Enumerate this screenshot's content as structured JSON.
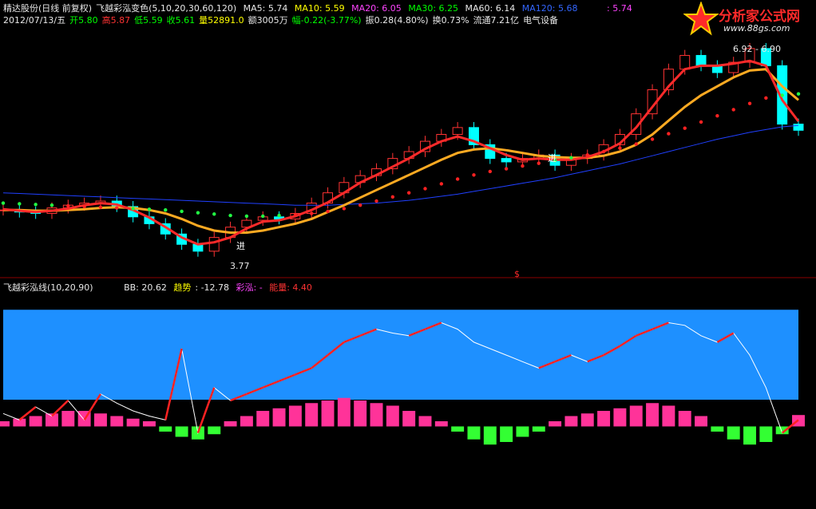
{
  "header": {
    "title": "精达股份(日线 前复权)",
    "indicator": "飞越彩泓变色(5,10,20,30,60,120)",
    "ma5_label": "MA5: 5.74",
    "ma10_label": "MA10: 5.59",
    "ma20_label": "MA20: 6.05",
    "ma30_label": "MA30: 6.25",
    "ma60_label": "MA60: 6.14",
    "ma120_label": "MA120: 5.68",
    "date": "2012/07/13/五",
    "open": "开5.80",
    "high": "高5.87",
    "low": "低5.59",
    "close": "收5.61",
    "volume": "量52891.0",
    "amount": "额3005万",
    "change": "幅-0.22(-3.77%)",
    "amplitude": "振0.28(4.80%)",
    "turnover": "换0.73%",
    "float_value": "流通7.21亿",
    "sector": "电气设备",
    "right_value": ": 5.74"
  },
  "watermark": {
    "title": "分析家公式网",
    "url": "www.88gs.com"
  },
  "indicator_header": {
    "name": "飞越彩泓线(10,20,90)",
    "bb": "BB: 20.62",
    "trend_label": "趋势",
    "trend_value": ": -12.78",
    "rainbow": "彩泓: -",
    "energy": "能量: 4.40"
  },
  "annotations": {
    "high_price": "6.92 - 6.90",
    "low_price": "3.77",
    "buy1": "进",
    "buy2": "进",
    "dollar": "$"
  },
  "chart_data": [
    {
      "type": "line",
      "name": "price",
      "xlabel": "",
      "ylabel": "",
      "ylim": [
        3.5,
        7.1
      ],
      "x": [
        0,
        5,
        10,
        15,
        20,
        25,
        30,
        35,
        40,
        45,
        50,
        55,
        60,
        65,
        70,
        75,
        80,
        85,
        90,
        95,
        100,
        105,
        110,
        115,
        120,
        125,
        130,
        135,
        140,
        145,
        150,
        155,
        160,
        165,
        170,
        175,
        180,
        185,
        190,
        195,
        200,
        205,
        210,
        215,
        220,
        225,
        230,
        235,
        240,
        245
      ],
      "close": [
        4.45,
        4.42,
        4.4,
        4.48,
        4.52,
        4.55,
        4.58,
        4.5,
        4.35,
        4.25,
        4.1,
        3.95,
        3.85,
        4.05,
        4.2,
        4.3,
        4.35,
        4.32,
        4.4,
        4.55,
        4.7,
        4.85,
        4.95,
        5.05,
        5.2,
        5.3,
        5.45,
        5.55,
        5.65,
        5.4,
        5.2,
        5.15,
        5.2,
        5.25,
        5.1,
        5.2,
        5.25,
        5.4,
        5.55,
        5.85,
        6.2,
        6.5,
        6.7,
        6.55,
        6.45,
        6.6,
        6.8,
        6.55,
        5.7,
        5.61
      ],
      "ma5": [
        4.46,
        4.44,
        4.42,
        4.44,
        4.47,
        4.52,
        4.55,
        4.53,
        4.45,
        4.34,
        4.2,
        4.05,
        3.95,
        3.98,
        4.05,
        4.18,
        4.28,
        4.3,
        4.36,
        4.45,
        4.56,
        4.7,
        4.85,
        4.96,
        5.08,
        5.2,
        5.34,
        5.45,
        5.52,
        5.45,
        5.35,
        5.25,
        5.18,
        5.2,
        5.18,
        5.18,
        5.22,
        5.3,
        5.42,
        5.65,
        5.95,
        6.25,
        6.5,
        6.55,
        6.55,
        6.58,
        6.62,
        6.55,
        6.05,
        5.74
      ],
      "ma20": [
        4.45,
        4.45,
        4.44,
        4.44,
        4.45,
        4.46,
        4.48,
        4.49,
        4.48,
        4.45,
        4.4,
        4.32,
        4.22,
        4.15,
        4.12,
        4.12,
        4.15,
        4.2,
        4.25,
        4.32,
        4.42,
        4.52,
        4.63,
        4.74,
        4.85,
        4.96,
        5.07,
        5.18,
        5.28,
        5.33,
        5.35,
        5.32,
        5.28,
        5.24,
        5.22,
        5.21,
        5.21,
        5.24,
        5.3,
        5.4,
        5.55,
        5.75,
        5.95,
        6.12,
        6.25,
        6.38,
        6.48,
        6.5,
        6.25,
        6.05
      ],
      "ma60": [
        4.55,
        4.54,
        4.53,
        4.52,
        4.51,
        4.5,
        4.49,
        4.48,
        4.47,
        4.46,
        4.45,
        4.43,
        4.41,
        4.39,
        4.37,
        4.36,
        4.36,
        4.37,
        4.38,
        4.4,
        4.43,
        4.47,
        4.52,
        4.58,
        4.64,
        4.7,
        4.76,
        4.83,
        4.9,
        4.96,
        5.01,
        5.05,
        5.09,
        5.13,
        5.17,
        5.21,
        5.25,
        5.3,
        5.35,
        5.41,
        5.48,
        5.56,
        5.64,
        5.73,
        5.82,
        5.91,
        6.0,
        6.08,
        6.12,
        6.14
      ],
      "ma120": [
        4.7,
        4.69,
        4.68,
        4.67,
        4.66,
        4.65,
        4.64,
        4.63,
        4.62,
        4.61,
        4.6,
        4.59,
        4.58,
        4.57,
        4.56,
        4.55,
        4.54,
        4.53,
        4.52,
        4.52,
        4.52,
        4.53,
        4.54,
        4.55,
        4.57,
        4.59,
        4.62,
        4.65,
        4.68,
        4.72,
        4.76,
        4.8,
        4.84,
        4.88,
        4.92,
        4.97,
        5.02,
        5.07,
        5.12,
        5.18,
        5.24,
        5.3,
        5.36,
        5.42,
        5.48,
        5.53,
        5.58,
        5.62,
        5.66,
        5.68
      ]
    },
    {
      "type": "line",
      "name": "indicator",
      "xlabel": "",
      "ylabel": "",
      "ylim": [
        -60,
        100
      ],
      "x": [
        0,
        5,
        10,
        15,
        20,
        25,
        30,
        35,
        40,
        45,
        50,
        55,
        60,
        65,
        70,
        75,
        80,
        85,
        90,
        95,
        100,
        105,
        110,
        115,
        120,
        125,
        130,
        135,
        140,
        145,
        150,
        155,
        160,
        165,
        170,
        175,
        180,
        185,
        190,
        195,
        200,
        205,
        210,
        215,
        220,
        225,
        230,
        235,
        240,
        245
      ],
      "trend": [
        10,
        5,
        15,
        8,
        20,
        5,
        25,
        18,
        12,
        8,
        5,
        60,
        -5,
        30,
        20,
        25,
        30,
        35,
        40,
        45,
        55,
        65,
        70,
        75,
        72,
        70,
        75,
        80,
        75,
        65,
        60,
        55,
        50,
        45,
        50,
        55,
        50,
        55,
        62,
        70,
        75,
        80,
        78,
        70,
        65,
        72,
        55,
        30,
        -5,
        5
      ],
      "energy": [
        2,
        3,
        4,
        5,
        6,
        6,
        5,
        4,
        3,
        2,
        -2,
        -4,
        -5,
        -3,
        2,
        4,
        6,
        7,
        8,
        9,
        10,
        11,
        10,
        9,
        8,
        6,
        4,
        2,
        -2,
        -5,
        -7,
        -6,
        -4,
        -2,
        2,
        4,
        5,
        6,
        7,
        8,
        9,
        8,
        6,
        4,
        -2,
        -5,
        -7,
        -6,
        -3,
        4.4
      ],
      "bb_level": 20.62
    }
  ]
}
